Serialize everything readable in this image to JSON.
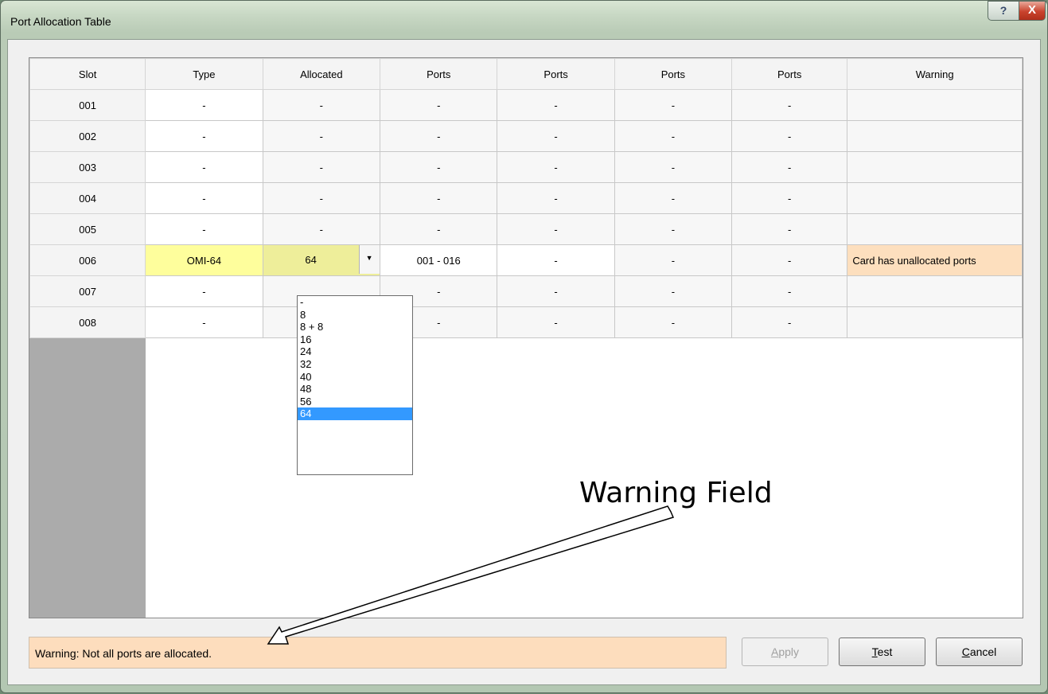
{
  "window": {
    "title": "Port Allocation Table",
    "help_glyph": "?",
    "close_glyph": "X"
  },
  "table": {
    "columns": [
      "Slot",
      "Type",
      "Allocated",
      "Ports",
      "Ports",
      "Ports",
      "Ports",
      "Warning"
    ],
    "rows": [
      {
        "slot": "001",
        "type": "-",
        "allocated": "-",
        "p1": "-",
        "p2": "-",
        "p3": "-",
        "p4": "-",
        "warning": ""
      },
      {
        "slot": "002",
        "type": "-",
        "allocated": "-",
        "p1": "-",
        "p2": "-",
        "p3": "-",
        "p4": "-",
        "warning": ""
      },
      {
        "slot": "003",
        "type": "-",
        "allocated": "-",
        "p1": "-",
        "p2": "-",
        "p3": "-",
        "p4": "-",
        "warning": ""
      },
      {
        "slot": "004",
        "type": "-",
        "allocated": "-",
        "p1": "-",
        "p2": "-",
        "p3": "-",
        "p4": "-",
        "warning": ""
      },
      {
        "slot": "005",
        "type": "-",
        "allocated": "-",
        "p1": "-",
        "p2": "-",
        "p3": "-",
        "p4": "-",
        "warning": ""
      },
      {
        "slot": "006",
        "type": "OMI-64",
        "allocated": "64",
        "p1": "001 - 016",
        "p2": "-",
        "p3": "-",
        "p4": "-",
        "warning": "Card has unallocated ports"
      },
      {
        "slot": "007",
        "type": "-",
        "allocated": "",
        "p1": "-",
        "p2": "-",
        "p3": "-",
        "p4": "-",
        "warning": ""
      },
      {
        "slot": "008",
        "type": "-",
        "allocated": "",
        "p1": "-",
        "p2": "-",
        "p3": "-",
        "p4": "-",
        "warning": ""
      }
    ],
    "dropdown_arrow_glyph": "▼"
  },
  "dropdown": {
    "options": [
      "-",
      "8",
      "8 + 8",
      "16",
      "24",
      "32",
      "40",
      "48",
      "56",
      "64"
    ],
    "selected": "64"
  },
  "annotation": {
    "label": "Warning Field"
  },
  "status": {
    "text": "Warning: Not all ports are allocated."
  },
  "buttons": {
    "apply": {
      "label": "Apply",
      "mnemonic": "A",
      "rest": "pply",
      "enabled": false
    },
    "test": {
      "label": "Test",
      "mnemonic": "T",
      "rest": "est",
      "enabled": true
    },
    "cancel": {
      "label": "Cancel",
      "mnemonic": "C",
      "rest": "ancel",
      "enabled": true
    }
  },
  "colors": {
    "warning_bg": "#fddfbe",
    "type_highlight": "#fefe9c",
    "allocated_highlight": "#eeee9a",
    "selection": "#3399ff"
  }
}
